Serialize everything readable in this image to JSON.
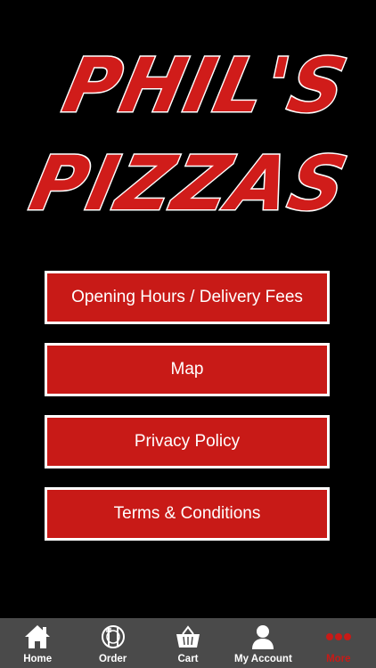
{
  "brand": {
    "line1": "PHIL'S",
    "line2": "PIZZAS",
    "fill_color": "#d01c1a",
    "outline_color": "#ffffff"
  },
  "menu": {
    "items": [
      {
        "label": "Opening Hours / Delivery Fees"
      },
      {
        "label": "Map"
      },
      {
        "label": "Privacy Policy"
      },
      {
        "label": "Terms & Conditions"
      }
    ],
    "button_color": "#c81a17",
    "border_color": "#ffffff"
  },
  "tabbar": {
    "background": "#4a4a4a",
    "active_color": "#c81a17",
    "tabs": [
      {
        "label": "Home",
        "icon": "home-icon"
      },
      {
        "label": "Order",
        "icon": "order-icon"
      },
      {
        "label": "Cart",
        "icon": "cart-icon"
      },
      {
        "label": "My Account",
        "icon": "account-icon"
      },
      {
        "label": "More",
        "icon": "more-icon",
        "active": true
      }
    ]
  }
}
